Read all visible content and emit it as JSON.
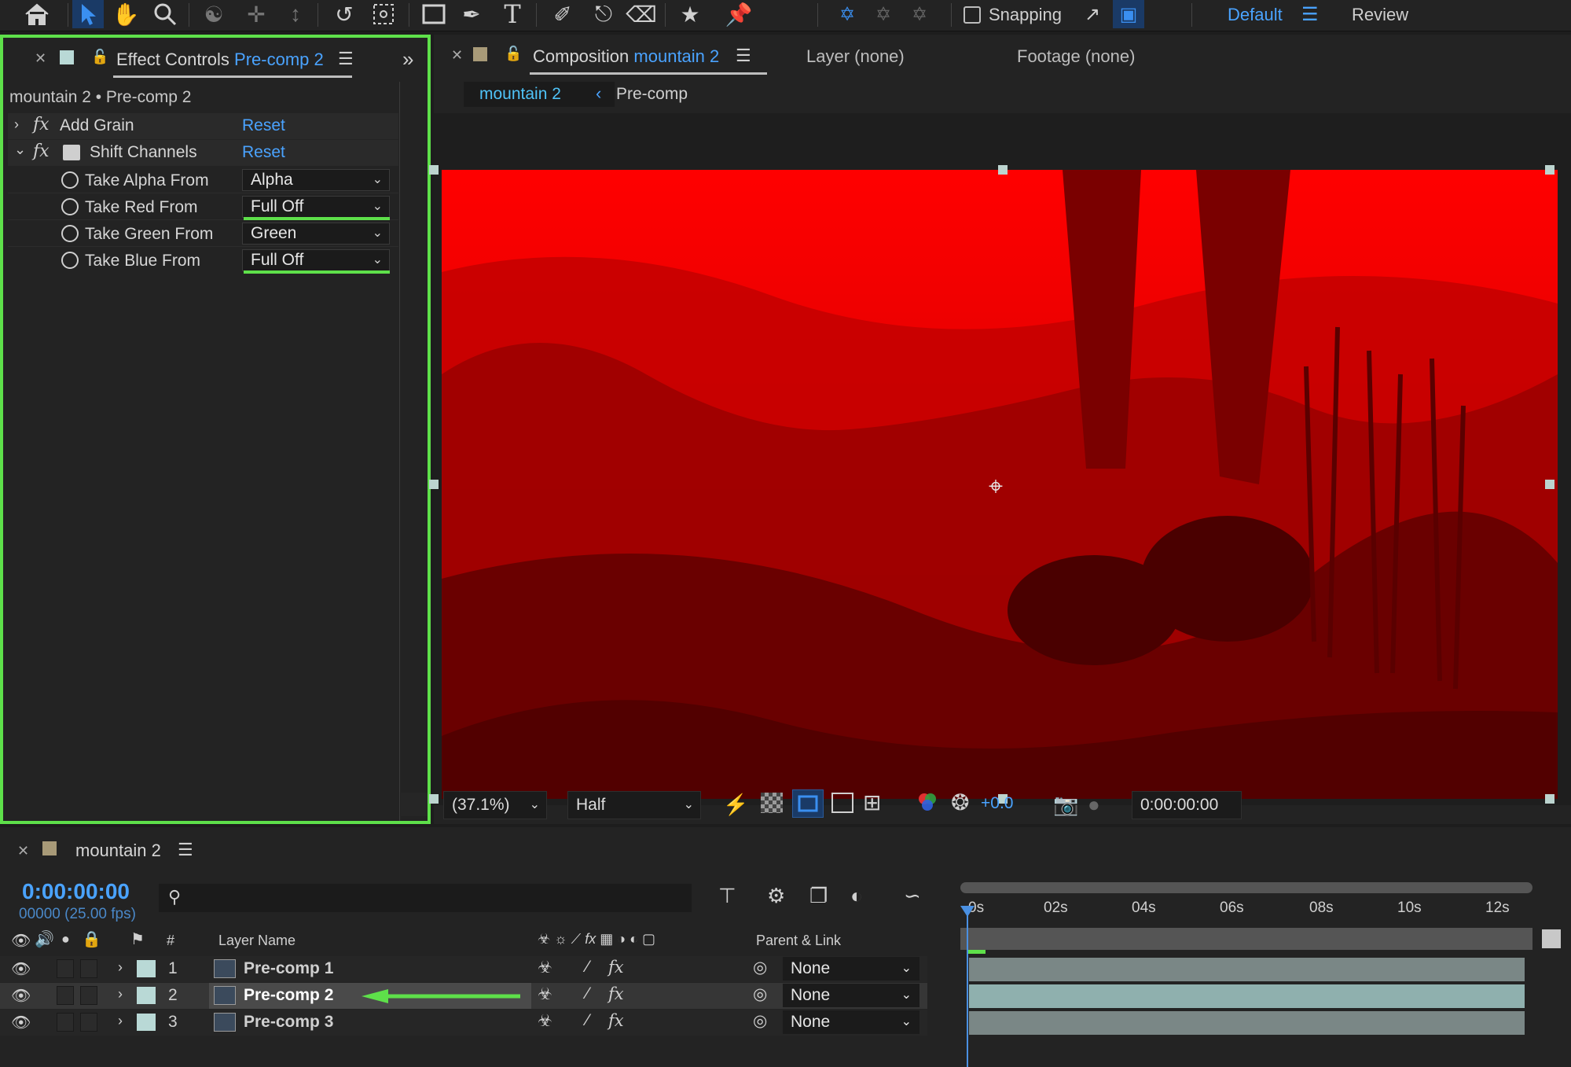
{
  "toolbar": {
    "tools": [
      "home-icon",
      "selection-tool-icon",
      "hand-tool-icon",
      "zoom-tool-icon",
      "orbit-camera-icon",
      "pan-camera-icon",
      "dolly-camera-icon",
      "rotation-tool-icon",
      "pan-behind-icon",
      "rectangle-tool-icon",
      "pen-tool-icon",
      "type-tool-icon",
      "brush-tool-icon",
      "clone-stamp-icon",
      "eraser-tool-icon",
      "roto-brush-icon",
      "puppet-pin-icon"
    ],
    "snapping_label": "Snapping",
    "workspace_default": "Default",
    "workspace_review": "Review"
  },
  "effect_controls": {
    "tab_prefix": "Effect Controls",
    "tab_layer": "Pre-comp 2",
    "breadcrumb": "mountain 2 • Pre-comp 2",
    "effects": [
      {
        "name": "Add Grain",
        "reset": "Reset",
        "expanded": false
      },
      {
        "name": "Shift Channels",
        "reset": "Reset",
        "expanded": true
      }
    ],
    "properties": [
      {
        "label": "Take Alpha From",
        "value": "Alpha",
        "highlighted": false
      },
      {
        "label": "Take Red From",
        "value": "Full Off",
        "highlighted": true
      },
      {
        "label": "Take Green From",
        "value": "Green",
        "highlighted": false
      },
      {
        "label": "Take Blue From",
        "value": "Full Off",
        "highlighted": true
      }
    ],
    "highlight_color": "#5ee04a"
  },
  "composition": {
    "tab_prefix": "Composition",
    "tab_name": "mountain 2",
    "layer_tab": "Layer (none)",
    "footage_tab": "Footage (none)",
    "nav_active": "mountain 2",
    "nav_next": "Pre-comp",
    "zoom": "(37.1%)",
    "resolution": "Half",
    "exposure": "+0.0",
    "timecode": "0:00:00:00",
    "tint_color": "#e00000"
  },
  "timeline": {
    "comp_name": "mountain 2",
    "current_time": "0:00:00:00",
    "frame_info": "00000 (25.00 fps)",
    "search_placeholder": "",
    "col_layer_name": "Layer Name",
    "col_number": "#",
    "col_parent": "Parent & Link",
    "ruler": [
      "0s",
      "02s",
      "04s",
      "06s",
      "08s",
      "10s",
      "12s"
    ],
    "layers": [
      {
        "num": "1",
        "name": "Pre-comp 1",
        "parent": "None",
        "selected": false
      },
      {
        "num": "2",
        "name": "Pre-comp 2",
        "parent": "None",
        "selected": true
      },
      {
        "num": "3",
        "name": "Pre-comp 3",
        "parent": "None",
        "selected": false
      }
    ]
  }
}
